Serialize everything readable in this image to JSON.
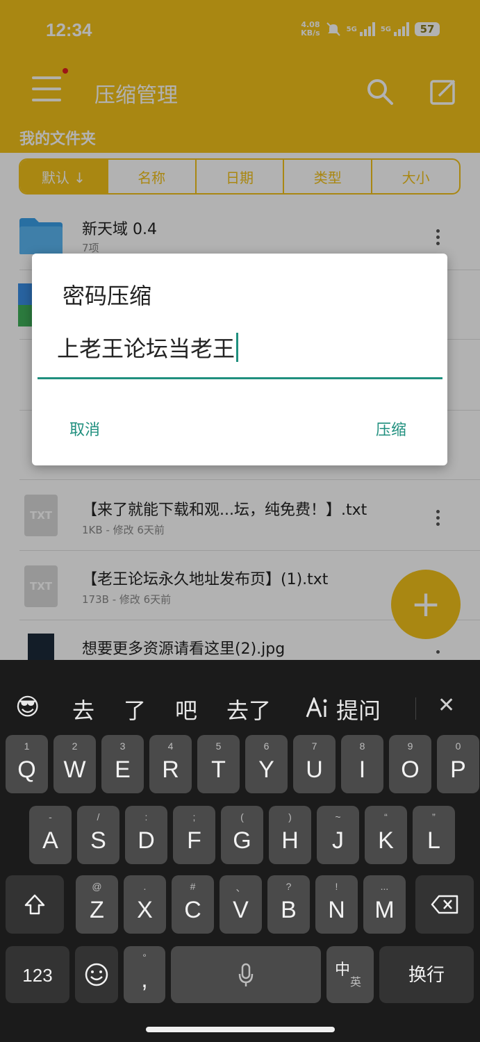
{
  "status": {
    "time": "12:34",
    "speed_value": "4.08",
    "speed_unit": "KB/s",
    "net1": "5G",
    "net2": "5G",
    "battery": "57"
  },
  "app": {
    "title": "压缩管理",
    "subtitle": "我的文件夹"
  },
  "sort_tabs": [
    "默认 ↓",
    "名称",
    "日期",
    "类型",
    "大小"
  ],
  "files": [
    {
      "name": "新天域 0.4",
      "meta": "7项",
      "icon": "folder-icon"
    },
    {
      "name": "【来了就能下载和观...坛，纯免费！】.txt",
      "meta": "1KB - 修改 6天前",
      "icon": "txt-file-icon",
      "icon_label": "TXT"
    },
    {
      "name": "【老王论坛永久地址发布页】(1).txt",
      "meta": "173B - 修改 6天前",
      "icon": "txt-file-icon",
      "icon_label": "TXT"
    },
    {
      "name": "想要更多资源请看这里(2).jpg",
      "meta": "",
      "icon": "image-thumbnail"
    }
  ],
  "fab": {
    "label": "+"
  },
  "dialog": {
    "title": "密码压缩",
    "input_value": "上老王论坛当老王",
    "cancel": "取消",
    "confirm": "压缩"
  },
  "suggestions": {
    "emoji": "😎",
    "items": [
      "去",
      "了",
      "吧",
      "去了"
    ],
    "ai": "提问",
    "close": "✕"
  },
  "keyboard": {
    "row1": [
      {
        "k": "Q",
        "h": "1"
      },
      {
        "k": "W",
        "h": "2"
      },
      {
        "k": "E",
        "h": "3"
      },
      {
        "k": "R",
        "h": "4"
      },
      {
        "k": "T",
        "h": "5"
      },
      {
        "k": "Y",
        "h": "6"
      },
      {
        "k": "U",
        "h": "7"
      },
      {
        "k": "I",
        "h": "8"
      },
      {
        "k": "O",
        "h": "9"
      },
      {
        "k": "P",
        "h": "0"
      }
    ],
    "row2": [
      {
        "k": "A",
        "h": "-"
      },
      {
        "k": "S",
        "h": "/"
      },
      {
        "k": "D",
        "h": ":"
      },
      {
        "k": "F",
        "h": ";"
      },
      {
        "k": "G",
        "h": "("
      },
      {
        "k": "H",
        "h": ")"
      },
      {
        "k": "J",
        "h": "~"
      },
      {
        "k": "K",
        "h": "“"
      },
      {
        "k": "L",
        "h": "”"
      }
    ],
    "row3": [
      {
        "k": "Z",
        "h": "@"
      },
      {
        "k": "X",
        "h": "."
      },
      {
        "k": "C",
        "h": "#"
      },
      {
        "k": "V",
        "h": "、"
      },
      {
        "k": "B",
        "h": "?"
      },
      {
        "k": "N",
        "h": "!"
      },
      {
        "k": "M",
        "h": "..."
      }
    ],
    "num": "123",
    "comma": ",",
    "comma_hint": "°",
    "lang_main": "中",
    "lang_sub": "英",
    "enter": "换行"
  }
}
